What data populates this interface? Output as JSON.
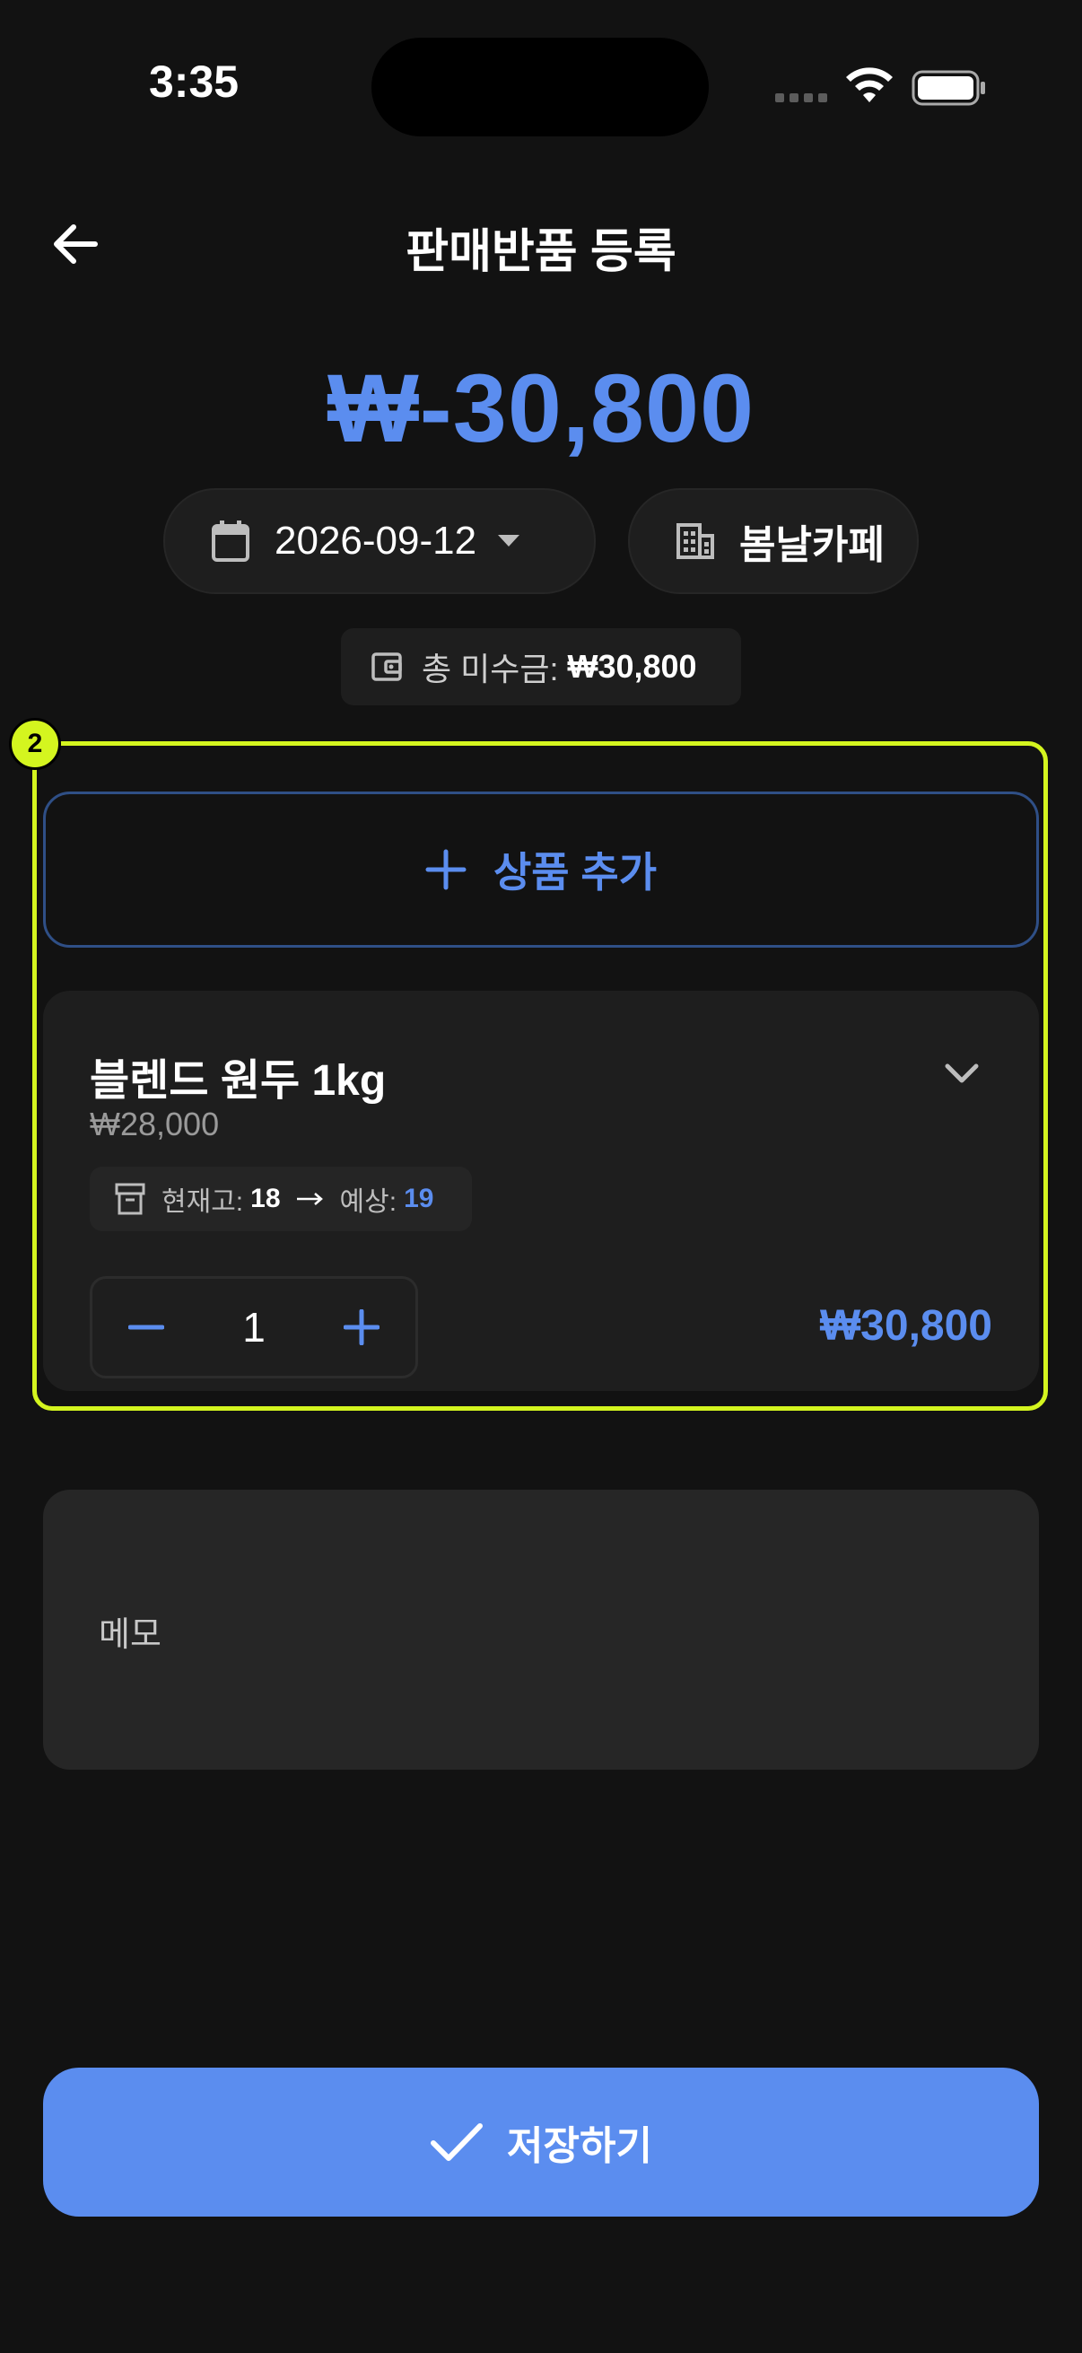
{
  "status_bar": {
    "time": "3:35",
    "wifi_icon": "wifi-icon",
    "battery_icon": "battery-icon"
  },
  "header": {
    "title": "판매반품 등록",
    "back_icon": "arrow-left-icon"
  },
  "summary": {
    "amount": "₩-30,800",
    "date": "2026-09-12",
    "place": "봄날카페",
    "receivable_label": "총 미수금:",
    "receivable_value": "₩30,800"
  },
  "annotation": {
    "marker": "2",
    "color": "#d4f51f"
  },
  "products": {
    "add_label": "상품 추가",
    "items": [
      {
        "name": "블렌드 원두 1kg",
        "unit_price": "₩28,000",
        "stock_label": "현재고:",
        "stock_value": "18",
        "expected_label": "예상:",
        "expected_value": "19",
        "quantity": "1",
        "line_total": "₩30,800"
      }
    ]
  },
  "memo": {
    "placeholder": "메모"
  },
  "footer": {
    "save_label": "저장하기"
  },
  "colors": {
    "accent": "#5b8def",
    "background": "#121212",
    "card": "#1e1e1e"
  }
}
